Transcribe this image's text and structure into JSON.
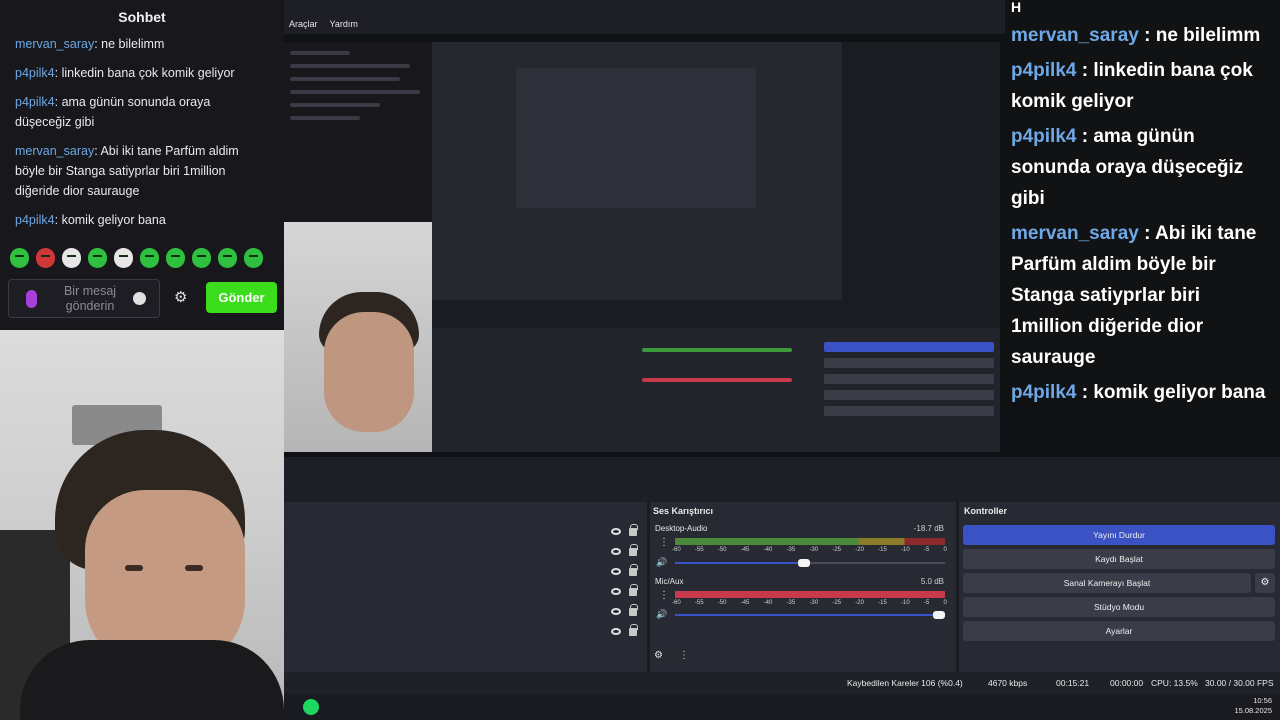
{
  "chat": {
    "title": "Sohbet",
    "messages": [
      {
        "user": "mervan_saray",
        "text": ": ne bilelimm"
      },
      {
        "user": "p4pilk4",
        "text": ": linkedin bana çok komik geliyor"
      },
      {
        "user": "p4pilk4",
        "text": ": ama günün sonunda oraya düşeceğiz gibi"
      },
      {
        "user": "mervan_saray",
        "text": ": Abi iki tane Parfüm aldim böyle bir Stanga satiyprlar biri 1million diğeride dior saurauge"
      },
      {
        "user": "p4pilk4",
        "text": ": komik geliyor bana"
      }
    ],
    "input_placeholder": "Bir mesaj gönderin",
    "send_label": "Gönder"
  },
  "menu": [
    "Araçlar",
    "Yardım"
  ],
  "overlay": {
    "header": "H",
    "messages": [
      {
        "user": "mervan_saray",
        "text": " : ne bilelimm"
      },
      {
        "user": "p4pilk4",
        "text": " : linkedin bana çok komik geliyor"
      },
      {
        "user": "p4pilk4",
        "text": " : ama günün sonunda oraya düşeceğiz gibi"
      },
      {
        "user": "mervan_saray",
        "text": " : Abi iki tane Parfüm aldim böyle bir Stanga satiyprlar biri 1million diğeride dior saurauge"
      },
      {
        "user": "p4pilk4",
        "text": " : komik geliyor bana"
      }
    ]
  },
  "mixer": {
    "title": "Ses Karıştırıcı",
    "channels": [
      {
        "name": "Desktop-Audio",
        "db": "-18.7 dB",
        "volume": 0.5
      },
      {
        "name": "Mic/Aux",
        "db": "5.0 dB",
        "volume": 1.0
      }
    ],
    "ticks": [
      "-60",
      "-55",
      "-50",
      "-45",
      "-40",
      "-35",
      "-30",
      "-25",
      "-20",
      "-15",
      "-10",
      "-5",
      "0"
    ]
  },
  "controls": {
    "title": "Kontroller",
    "stop_stream": "Yayını Durdur",
    "start_record": "Kaydı Başlat",
    "virtual_cam": "Sanal Kamerayı Başlat",
    "studio_mode": "Stüdyo Modu",
    "settings": "Ayarlar"
  },
  "status": {
    "dropped_frames": "Kaybedilen Kareler 106 (%0.4)",
    "bitrate": "4670 kbps",
    "stream_time": "00:15:21",
    "record_time": "00:00:00",
    "cpu": "CPU: 13.5%",
    "fps": "30.00 / 30.00 FPS"
  },
  "clock": {
    "time": "10:56",
    "date": "15.08.2025"
  },
  "colors": {
    "accent": "#3a52c4",
    "send": "#3bdc1b",
    "username": "#6ea8e6"
  }
}
